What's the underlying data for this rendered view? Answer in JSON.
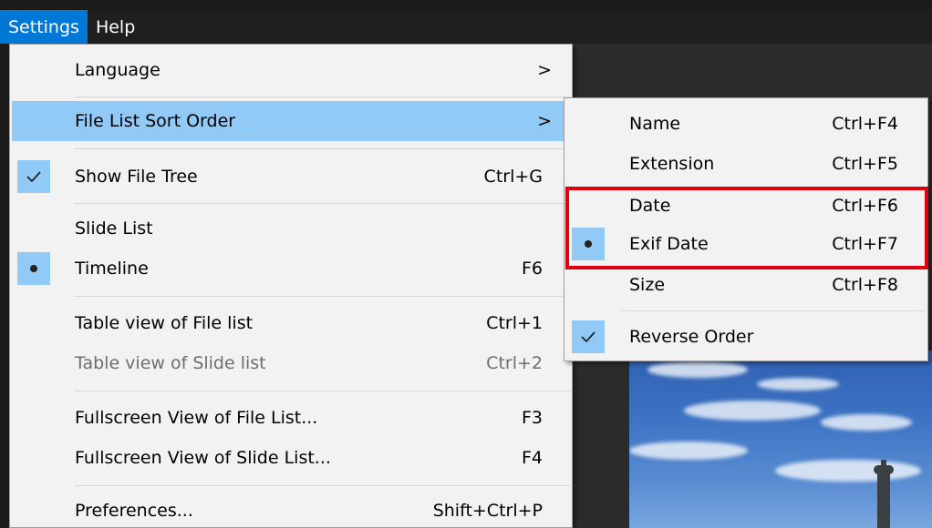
{
  "menubar": {
    "items": [
      {
        "label": "Settings",
        "active": true
      },
      {
        "label": "Help",
        "active": false
      }
    ]
  },
  "settings_menu": {
    "items": [
      {
        "label": "Language",
        "submenu_arrow": ">"
      },
      {
        "label": "File List Sort Order",
        "submenu_arrow": ">",
        "highlighted": true
      },
      {
        "label": "Show File Tree",
        "shortcut": "Ctrl+G",
        "mark": "check"
      },
      {
        "label": "Slide List"
      },
      {
        "label": "Timeline",
        "shortcut": "F6",
        "mark": "bullet"
      },
      {
        "label": "Table view of File list",
        "shortcut": "Ctrl+1"
      },
      {
        "label": "Table view of Slide list",
        "shortcut": "Ctrl+2",
        "disabled": true
      },
      {
        "label": "Fullscreen View of File List...",
        "shortcut": "F3"
      },
      {
        "label": "Fullscreen View of Slide List...",
        "shortcut": "F4"
      },
      {
        "label": "Preferences...",
        "shortcut": "Shift+Ctrl+P"
      }
    ]
  },
  "sort_submenu": {
    "items": [
      {
        "label": "Name",
        "shortcut": "Ctrl+F4"
      },
      {
        "label": "Extension",
        "shortcut": "Ctrl+F5"
      },
      {
        "label": "Date",
        "shortcut": "Ctrl+F6"
      },
      {
        "label": "Exif Date",
        "shortcut": "Ctrl+F7",
        "mark": "bullet"
      },
      {
        "label": "Size",
        "shortcut": "Ctrl+F8"
      },
      {
        "label": "Reverse Order",
        "mark": "check"
      }
    ]
  },
  "colors": {
    "menubar_active": "#0078d7",
    "menu_highlight": "#91c9f7",
    "annotation_box": "#e0000f"
  },
  "icons": {
    "check": "checkmark-icon",
    "bullet": "bullet-icon",
    "arrow": "chevron-right-icon"
  }
}
